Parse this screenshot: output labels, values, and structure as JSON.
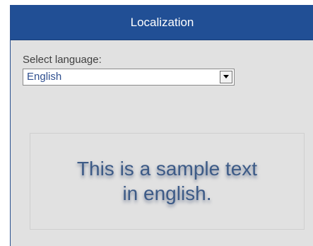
{
  "header": {
    "title": "Localization"
  },
  "language_select": {
    "label": "Select language:",
    "selected_value": "English"
  },
  "sample": {
    "line1": "This is a sample text",
    "line2": "in english."
  },
  "icons": {
    "dropdown": "chevron-down-icon"
  },
  "colors": {
    "header_bg": "#214f95",
    "panel_bg": "#e1e1e1",
    "sample_text": "#3d5b87"
  }
}
